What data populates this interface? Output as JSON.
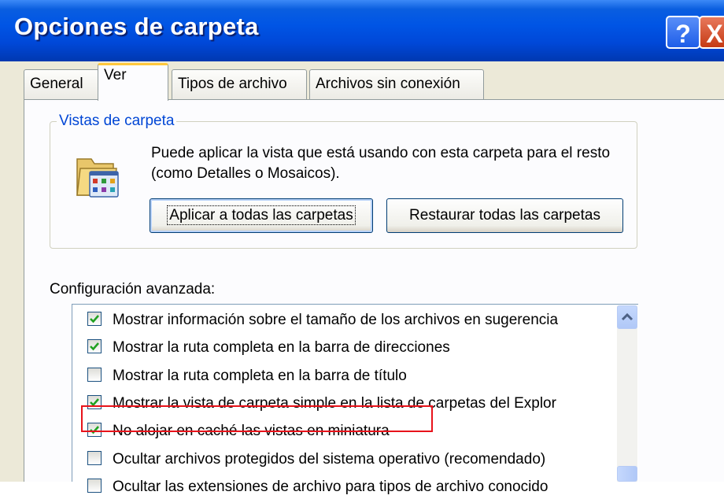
{
  "window": {
    "title": "Opciones de carpeta",
    "help_label": "?",
    "close_label": "X"
  },
  "tabs": [
    {
      "label": "General",
      "active": false
    },
    {
      "label": "Ver",
      "active": true
    },
    {
      "label": "Tipos de archivo",
      "active": false
    },
    {
      "label": "Archivos sin conexión",
      "active": false
    }
  ],
  "folder_views": {
    "group_title": "Vistas de carpeta",
    "description": "Puede aplicar la vista que está usando con esta carpeta para el resto (como Detalles o Mosaicos).",
    "apply_button": "Aplicar a todas las carpetas",
    "restore_button": "Restaurar todas las carpetas",
    "icon": "folder-options-icon"
  },
  "advanced": {
    "label": "Configuración avanzada:",
    "items": [
      {
        "label": "Mostrar información sobre el tamaño de los archivos en sugerencia",
        "checked": true
      },
      {
        "label": "Mostrar la ruta completa en la barra de direcciones",
        "checked": true
      },
      {
        "label": "Mostrar la ruta completa en la barra de título",
        "checked": false
      },
      {
        "label": "Mostrar la vista de carpeta simple en la lista de carpetas del Explor",
        "checked": true
      },
      {
        "label": "No alojar en caché las vistas en miniatura",
        "checked": true,
        "highlighted": true
      },
      {
        "label": "Ocultar archivos protegidos del sistema operativo (recomendado)",
        "checked": false
      },
      {
        "label": "Ocultar las extensiones de archivo para tipos de archivo conocido",
        "checked": false
      }
    ]
  },
  "colors": {
    "title_bar": "#0055e5",
    "dialog_bg": "#ece9d8",
    "group_title": "#0046d5",
    "highlight": "#e8131b",
    "active_tab_accent": "#ffc83c"
  }
}
